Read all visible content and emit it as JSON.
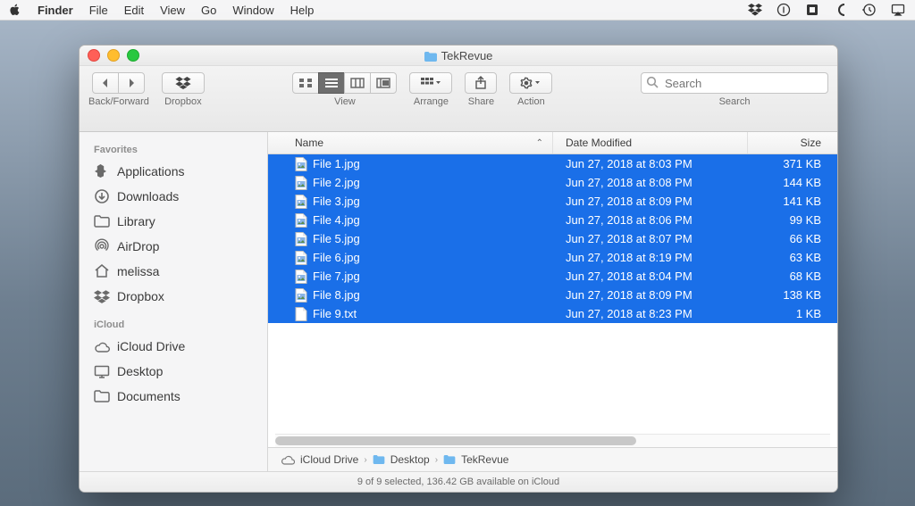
{
  "menubar": {
    "app_name": "Finder",
    "items": [
      "File",
      "Edit",
      "View",
      "Go",
      "Window",
      "Help"
    ]
  },
  "window": {
    "title": "TekRevue"
  },
  "toolbar": {
    "back_forward_label": "Back/Forward",
    "dropbox_label": "Dropbox",
    "view_label": "View",
    "arrange_label": "Arrange",
    "share_label": "Share",
    "action_label": "Action",
    "search_label": "Search",
    "search_placeholder": "Search"
  },
  "sidebar": {
    "favorites_head": "Favorites",
    "favorites": [
      {
        "icon": "applications-icon",
        "label": "Applications"
      },
      {
        "icon": "downloads-icon",
        "label": "Downloads"
      },
      {
        "icon": "folder-icon",
        "label": "Library"
      },
      {
        "icon": "airdrop-icon",
        "label": "AirDrop"
      },
      {
        "icon": "home-icon",
        "label": "melissa"
      },
      {
        "icon": "dropbox-icon",
        "label": "Dropbox"
      }
    ],
    "icloud_head": "iCloud",
    "icloud": [
      {
        "icon": "icloud-icon",
        "label": "iCloud Drive"
      },
      {
        "icon": "desktop-icon",
        "label": "Desktop"
      },
      {
        "icon": "folder-icon",
        "label": "Documents"
      }
    ]
  },
  "columns": {
    "name": "Name",
    "date": "Date Modified",
    "size": "Size"
  },
  "files": [
    {
      "name": "File 1.jpg",
      "date": "Jun 27, 2018 at 8:03 PM",
      "size": "371 KB",
      "type": "jpg"
    },
    {
      "name": "File 2.jpg",
      "date": "Jun 27, 2018 at 8:08 PM",
      "size": "144 KB",
      "type": "jpg"
    },
    {
      "name": "File 3.jpg",
      "date": "Jun 27, 2018 at 8:09 PM",
      "size": "141 KB",
      "type": "jpg"
    },
    {
      "name": "File 4.jpg",
      "date": "Jun 27, 2018 at 8:06 PM",
      "size": "99 KB",
      "type": "jpg"
    },
    {
      "name": "File 5.jpg",
      "date": "Jun 27, 2018 at 8:07 PM",
      "size": "66 KB",
      "type": "jpg"
    },
    {
      "name": "File 6.jpg",
      "date": "Jun 27, 2018 at 8:19 PM",
      "size": "63 KB",
      "type": "jpg"
    },
    {
      "name": "File 7.jpg",
      "date": "Jun 27, 2018 at 8:04 PM",
      "size": "68 KB",
      "type": "jpg"
    },
    {
      "name": "File 8.jpg",
      "date": "Jun 27, 2018 at 8:09 PM",
      "size": "138 KB",
      "type": "jpg"
    },
    {
      "name": "File 9.txt",
      "date": "Jun 27, 2018 at 8:23 PM",
      "size": "1 KB",
      "type": "txt"
    }
  ],
  "pathbar": {
    "p0": "iCloud Drive",
    "p1": "Desktop",
    "p2": "TekRevue"
  },
  "status": "9 of 9 selected, 136.42 GB available on iCloud"
}
